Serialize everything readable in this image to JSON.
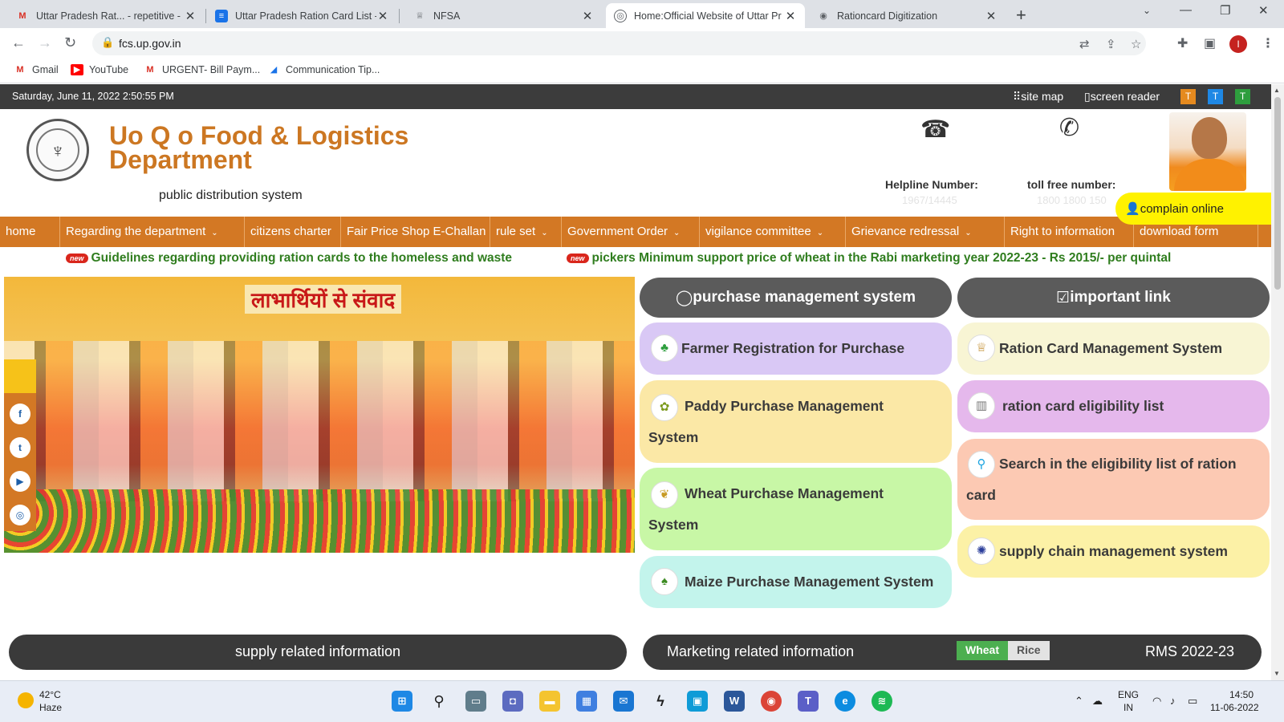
{
  "browser": {
    "tabs": [
      {
        "title": "Uttar Pradesh Rat... - repetitive -",
        "icon": "gmail-icon",
        "fav": "M",
        "fav_color": "#d93025"
      },
      {
        "title": "Uttar Pradesh Ration Card List - (",
        "icon": "docs-icon",
        "fav": "≡",
        "fav_color": "#1a73e8"
      },
      {
        "title": "NFSA",
        "icon": "emblem-icon",
        "fav": "♕",
        "fav_color": "#5f6368"
      },
      {
        "title": "Home:Official Website of Uttar Pr",
        "icon": "site-icon",
        "fav": "◎",
        "fav_color": "#5f6368"
      },
      {
        "title": "Rationcard Digitization",
        "icon": "globe-icon",
        "fav": "◉",
        "fav_color": "#5f6368"
      }
    ],
    "url": "fcs.up.gov.in",
    "bookmarks": [
      {
        "label": "Gmail",
        "fav": "M",
        "color": "#d93025"
      },
      {
        "label": "YouTube",
        "fav": "▶",
        "color": "#ff0000"
      },
      {
        "label": "URGENT- Bill Paym...",
        "fav": "M",
        "color": "#d93025"
      },
      {
        "label": "Communication Tip...",
        "fav": "◢",
        "color": "#1a73e8"
      }
    ],
    "profile_initial": "I"
  },
  "site": {
    "topbar": {
      "datetime": "Saturday, June 11, 2022 2:50:55 PM",
      "sitemap": "site map",
      "screen_reader": "screen reader",
      "text_buttons": [
        {
          "label": "T",
          "color": "#e58a1f"
        },
        {
          "label": "T",
          "color": "#1e88e5"
        },
        {
          "label": "T",
          "color": "#2e9e3e"
        }
      ]
    },
    "header": {
      "title_line1": "Uo Q o Food & Logistics",
      "title_line2": "Department",
      "subtitle": "public distribution system",
      "helpline_label": "Helpline Number:",
      "helpline_value": "1967/14445",
      "tollfree_label": "toll free number:",
      "tollfree_value": "1800 1800 150",
      "complain": "complain online"
    },
    "menu": [
      {
        "label": "home",
        "dropdown": false
      },
      {
        "label": "Regarding the department",
        "dropdown": true
      },
      {
        "label": "citizens charter",
        "dropdown": false
      },
      {
        "label": "Fair Price Shop E-Challan",
        "dropdown": false
      },
      {
        "label": "rule set",
        "dropdown": true
      },
      {
        "label": "Government Order",
        "dropdown": true
      },
      {
        "label": "vigilance committee",
        "dropdown": true
      },
      {
        "label": "Grievance redressal",
        "dropdown": true
      },
      {
        "label": "Right to information",
        "dropdown": false
      },
      {
        "label": "download form",
        "dropdown": false
      }
    ],
    "news": {
      "badge": "new",
      "items": [
        "Guidelines regarding providing ration cards to the homeless and waste",
        "pickers Minimum support price of wheat in the Rabi marketing year 2022-23 - Rs 2015/- per quintal"
      ]
    },
    "hero": {
      "banner_text": "लाभार्थियों से संवाद"
    },
    "social": [
      "f",
      "t",
      "▶",
      "◎"
    ],
    "purchase": {
      "heading": "purchase management system",
      "items": [
        {
          "line1": "Farmer Registration for Purchase",
          "line2": "",
          "color": "#d9c8f5"
        },
        {
          "line1": "Paddy Purchase Management",
          "line2": "System",
          "color": "#fbe8a6"
        },
        {
          "line1": "Wheat Purchase Management",
          "line2": "System",
          "color": "#c8f7a6"
        },
        {
          "line1": "Maize Purchase Management System",
          "line2": "",
          "color": "#c3f4ec"
        }
      ]
    },
    "important": {
      "heading": "important link",
      "items": [
        {
          "line1": "Ration Card Management System",
          "line2": "",
          "color": "#f8f5d4"
        },
        {
          "line1": "ration card eligibility list",
          "line2": "",
          "color": "#e5b8ec"
        },
        {
          "line1": "Search in the eligibility list of ration",
          "line2": "card",
          "color": "#fcc9b3"
        },
        {
          "line1": "supply chain management system",
          "line2": "",
          "color": "#fcf1a6"
        }
      ]
    },
    "supply_heading": "supply related information",
    "marketing": {
      "heading": "Marketing related information",
      "toggle": [
        "Wheat",
        "Rice"
      ],
      "selected": "Wheat",
      "season": "RMS 2022-23"
    }
  },
  "taskbar": {
    "weather_temp": "42°C",
    "weather_desc": "Haze",
    "lang1": "ENG",
    "lang2": "IN",
    "time": "14:50",
    "date": "11-06-2022"
  }
}
